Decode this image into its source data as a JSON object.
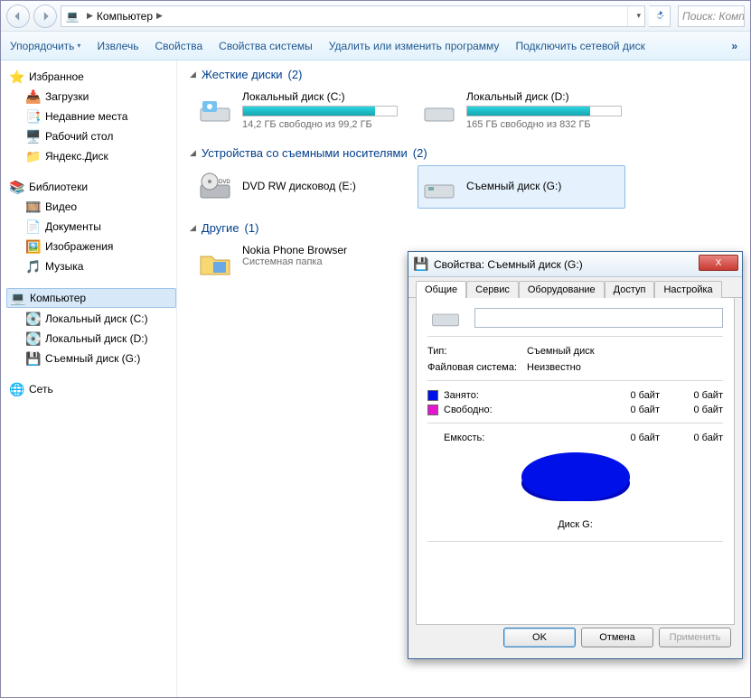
{
  "nav": {
    "path_label": "Компьютер",
    "path_sep": "▶",
    "search_placeholder": "Поиск: Комп"
  },
  "toolbar": {
    "organize": "Упорядочить",
    "extract": "Извлечь",
    "properties": "Свойства",
    "sys_properties": "Свойства системы",
    "uninstall": "Удалить или изменить программу",
    "map_drive": "Подключить сетевой диск",
    "overflow": "»"
  },
  "sidebar": {
    "favorites": {
      "label": "Избранное",
      "items": [
        "Загрузки",
        "Недавние места",
        "Рабочий стол",
        "Яндекс.Диск"
      ]
    },
    "libraries": {
      "label": "Библиотеки",
      "items": [
        "Видео",
        "Документы",
        "Изображения",
        "Музыка"
      ]
    },
    "computer": {
      "label": "Компьютер",
      "items": [
        "Локальный диск (C:)",
        "Локальный диск (D:)",
        "Съемный диск (G:)"
      ]
    },
    "network": {
      "label": "Сеть"
    }
  },
  "sections": {
    "hdd": {
      "title": "Жесткие диски",
      "count": "(2)",
      "drives": [
        {
          "name": "Локальный диск (C:)",
          "sub": "14,2 ГБ свободно из 99,2 ГБ",
          "fill_pct": 86
        },
        {
          "name": "Локальный диск (D:)",
          "sub": "165 ГБ свободно из 832 ГБ",
          "fill_pct": 80
        }
      ]
    },
    "removable": {
      "title": "Устройства со съемными носителями",
      "count": "(2)",
      "items": [
        {
          "name": "DVD RW дисковод (E:)"
        },
        {
          "name": "Съемный диск (G:)",
          "selected": true
        }
      ]
    },
    "other": {
      "title": "Другие",
      "count": "(1)",
      "items": [
        {
          "name": "Nokia Phone Browser",
          "sub": "Системная папка"
        }
      ]
    }
  },
  "dialog": {
    "title": "Свойства: Съемный диск (G:)",
    "close": "X",
    "tabs": [
      "Общие",
      "Сервис",
      "Оборудование",
      "Доступ",
      "Настройка"
    ],
    "type_k": "Тип:",
    "type_v": "Съемный диск",
    "fs_k": "Файловая система:",
    "fs_v": "Неизвестно",
    "used_label": "Занято:",
    "used_v1": "0 байт",
    "used_v2": "0 байт",
    "free_label": "Свободно:",
    "free_v1": "0 байт",
    "free_v2": "0 байт",
    "cap_label": "Емкость:",
    "cap_v1": "0 байт",
    "cap_v2": "0 байт",
    "disk_label": "Диск G:",
    "ok": "OK",
    "cancel": "Отмена",
    "apply": "Применить"
  },
  "icons": {
    "star": "⭐",
    "download": "📥",
    "recent": "📑",
    "desktop": "🖥️",
    "ydisk": "📁",
    "lib": "📚",
    "video": "🎞️",
    "doc": "📄",
    "img": "🖼️",
    "music": "🎵",
    "computer": "💻",
    "disk": "💽",
    "usb": "💾",
    "net": "🌐",
    "dvd": "📀",
    "folder": "📁",
    "extern": "🔌"
  }
}
